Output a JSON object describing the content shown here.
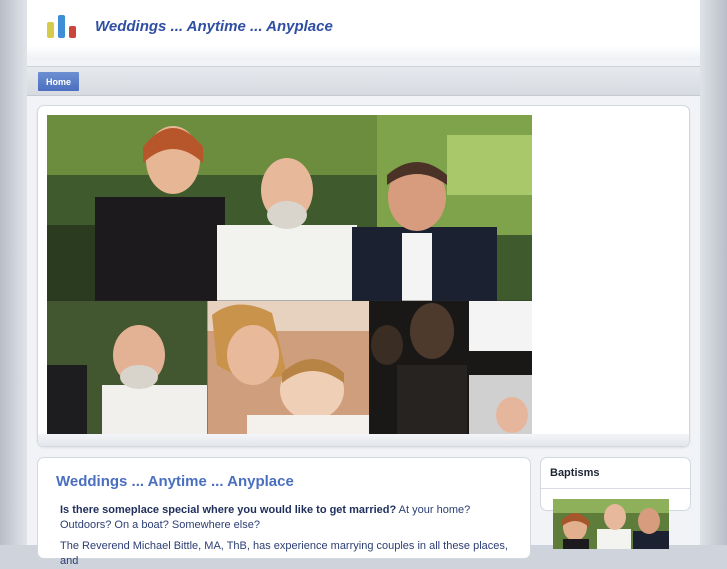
{
  "site": {
    "title": "Weddings ... Anytime ... Anyplace"
  },
  "nav": {
    "home_label": "Home"
  },
  "main": {
    "title": "Weddings ... Anytime ... Anyplace",
    "question": "Is there someplace special where you would like to get married?",
    "question_rest": " At your home? Outdoors? On a boat? Somewhere else?",
    "paragraph2": "The Reverend Michael Bittle, MA, ThB, has experience marrying couples in all these places, and"
  },
  "sidebar": {
    "title": "Baptisms"
  },
  "colors": {
    "accent": "#4a6fbf",
    "title_blue": "#2f4fa2",
    "nav_button": "#5a7cc8",
    "logo_bars": [
      "#d4cc4a",
      "#3e8ed6",
      "#c9463c"
    ]
  }
}
